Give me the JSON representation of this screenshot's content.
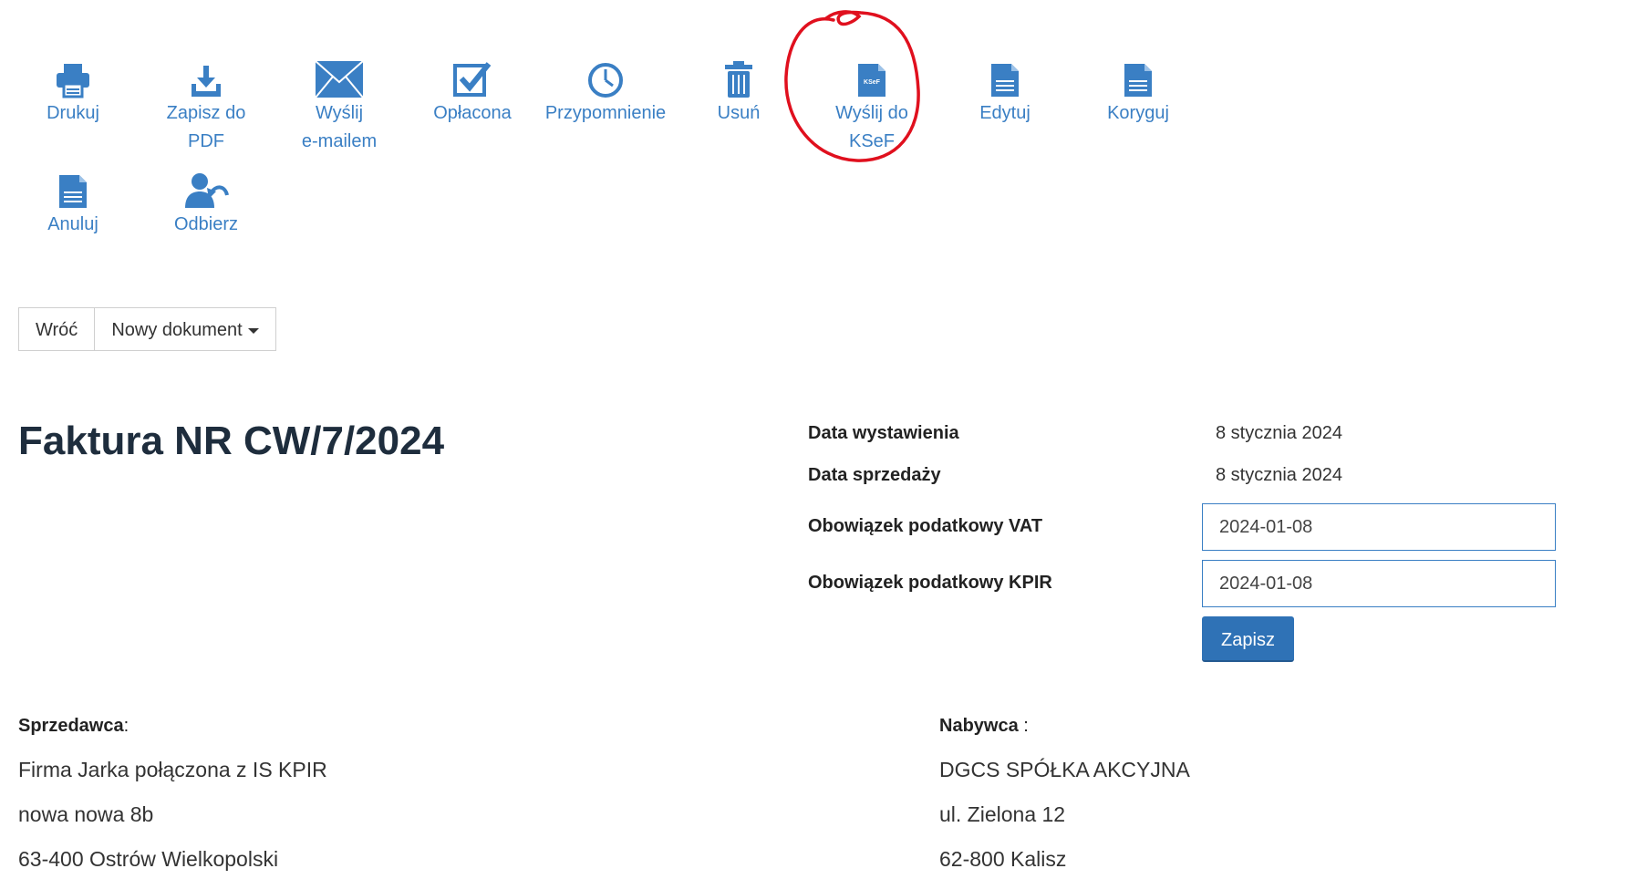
{
  "toolbar": {
    "print": "Drukuj",
    "pdf_line1": "Zapisz do",
    "pdf_line2": "PDF",
    "email_line1": "Wyślij",
    "email_line2": "e-mailem",
    "paid": "Opłacona",
    "reminder": "Przypomnienie",
    "delete": "Usuń",
    "ksef_line1": "Wyślij do",
    "ksef_line2": "KSeF",
    "ksef_icon_text": "KSeF",
    "edit": "Edytuj",
    "correct": "Koryguj",
    "cancel": "Anuluj",
    "receive": "Odbierz"
  },
  "actions": {
    "back": "Wróć",
    "new_document": "Nowy dokument"
  },
  "invoice": {
    "title": "Faktura NR CW/7/2024",
    "issue_date_label": "Data wystawienia",
    "issue_date": "8 stycznia 2024",
    "sale_date_label": "Data sprzedaży",
    "sale_date": "8 stycznia 2024",
    "vat_label": "Obowiązek podatkowy VAT",
    "vat_value": "2024-01-08",
    "kpir_label": "Obowiązek podatkowy KPIR",
    "kpir_value": "2024-01-08",
    "save": "Zapisz"
  },
  "seller": {
    "label": "Sprzedawca",
    "suffix": ":",
    "name": "Firma Jarka połączona z IS KPIR",
    "street": "nowa nowa 8b",
    "city": "63-400 Ostrów Wielkopolski"
  },
  "buyer": {
    "label": "Nabywca",
    "suffix": " :",
    "name": "DGCS SPÓŁKA AKCYJNA",
    "street": "ul. Zielona 12",
    "city": "62-800 Kalisz"
  },
  "colors": {
    "accent": "#3a7fc4",
    "annotation": "#e0101e"
  }
}
